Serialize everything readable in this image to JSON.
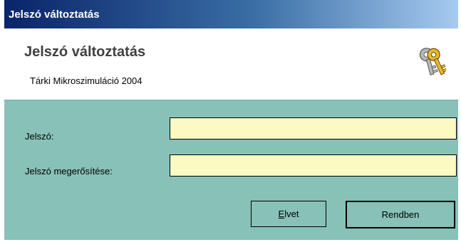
{
  "window": {
    "title": "Jelszó változtatás"
  },
  "header": {
    "title": "Jelszó változtatás",
    "subtitle": "Tárki Mikroszimuláció 2004",
    "icon": "keys-icon"
  },
  "form": {
    "password_label": "Jelszó:",
    "password_value": "",
    "confirm_label": "Jelszó megerősítése:",
    "confirm_value": ""
  },
  "buttons": {
    "cancel_accel": "E",
    "cancel_rest": "lvet",
    "ok_label": "Rendben"
  },
  "colors": {
    "panel_bg": "#87c1b7",
    "input_bg": "#fcf9c3",
    "titlebar_start": "#0a246a",
    "titlebar_end": "#a6caf0"
  }
}
